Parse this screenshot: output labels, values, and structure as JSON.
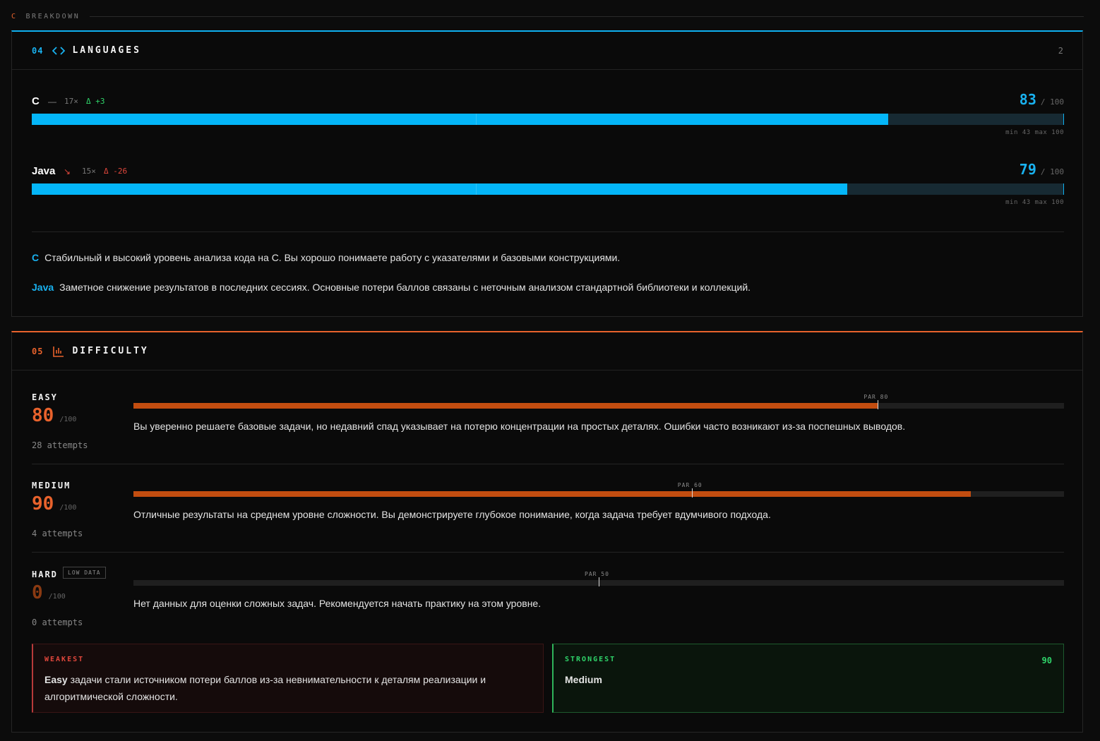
{
  "breakdown": {
    "letter": "C",
    "label": "BREAKDOWN"
  },
  "languages": {
    "number": "04",
    "title": "LANGUAGES",
    "count": "2",
    "items": [
      {
        "name": "C",
        "trend": "—",
        "attempts": "17×",
        "delta": "Δ +3",
        "delta_color": "#2fd46a",
        "score": "83",
        "out_of": "/ 100",
        "value": 83,
        "range": "min 43   max 100"
      },
      {
        "name": "Java",
        "trend": "↘",
        "attempts": "15×",
        "delta": "Δ -26",
        "delta_color": "#e0473c",
        "score": "79",
        "out_of": "/ 100",
        "value": 79,
        "range": "min 43   max 100"
      }
    ],
    "notes": [
      {
        "tag": "C",
        "text": "Стабильный и высокий уровень анализа кода на С. Вы хорошо понимаете работу с указателями и базовыми конструкциями."
      },
      {
        "tag": "Java",
        "text": "Заметное снижение результатов в последних сессиях. Основные потери баллов связаны с неточным анализом стандартной библиотеки и коллекций."
      }
    ]
  },
  "difficulty": {
    "number": "05",
    "title": "DIFFICULTY",
    "levels": [
      {
        "name": "EASY",
        "score": "80",
        "value": 80,
        "out_of": "/100",
        "attempts": "28 attempts",
        "par_label": "PAR 80",
        "par": 80,
        "color": "#e8622c",
        "desc": "Вы уверенно решаете базовые задачи, но недавний спад указывает на потерю концентрации на простых деталях. Ошибки часто возникают из-за поспешных выводов."
      },
      {
        "name": "MEDIUM",
        "score": "90",
        "value": 90,
        "out_of": "/100",
        "attempts": "4 attempts",
        "par_label": "PAR 60",
        "par": 60,
        "color": "#e8622c",
        "desc": "Отличные результаты на среднем уровне сложности. Вы демонстрируете глубокое понимание, когда задача требует вдумчивого подхода."
      },
      {
        "name": "HARD",
        "badge": "LOW DATA",
        "score": "0",
        "value": 0,
        "out_of": "/100",
        "attempts": "0 attempts",
        "par_label": "PAR 50",
        "par": 50,
        "color": "#8a3a12",
        "desc": "Нет данных для оценки сложных задач. Рекомендуется начать практику на этом уровне."
      }
    ],
    "weakest": {
      "label": "WEAKEST",
      "emphasis": "Easy",
      "text": "задачи стали источником потери баллов из-за невнимательности к деталям реализации и алгоритмической сложности."
    },
    "strongest": {
      "label": "STRONGEST",
      "value": "90",
      "text": "Medium"
    }
  }
}
